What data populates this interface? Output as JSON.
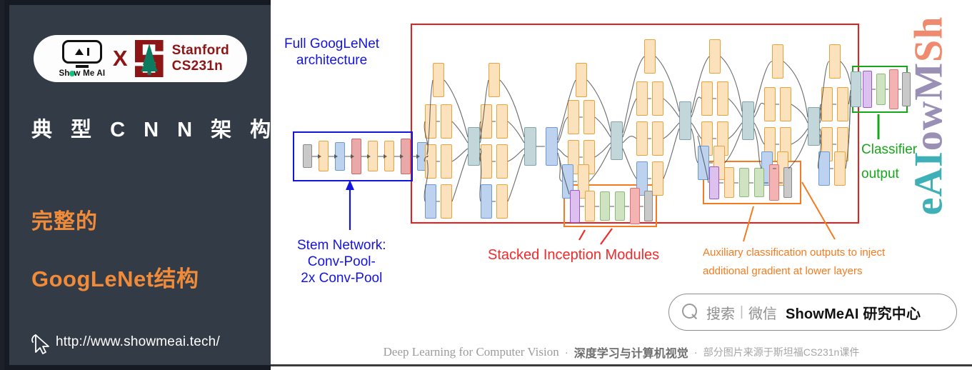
{
  "sidebar": {
    "logo": {
      "showmeai_label": "Show Me AI",
      "x_label": "X",
      "stanford_line1": "Stanford",
      "stanford_line2": "CS231n"
    },
    "title": "典 型 C N N 架 构",
    "subtitle_line1": "完整的",
    "subtitle_line2": "GoogLeNet结构",
    "url": "http://www.showmeai.tech/",
    "cursor_icon": "cursor-pointer-icon",
    "colors": {
      "background": "#333b47",
      "accent_orange": "#f08b3a",
      "stanford_red": "#8c1515"
    }
  },
  "diagram": {
    "title": "Full GoogLeNet architecture",
    "labels": {
      "full_architecture": "Full GoogLeNet\narchitecture",
      "full_architecture_l1": "Full GoogLeNet",
      "full_architecture_l2": "architecture",
      "stem_l1": "Stem Network:",
      "stem_l2": "Conv-Pool-",
      "stem_l3": "2x Conv-Pool",
      "stacked_inception": "Stacked Inception Modules",
      "auxiliary_l1": "Auxiliary classification outputs to inject",
      "auxiliary_l2": "additional gradient at lower layers",
      "classifier_l1": "Classifier",
      "classifier_l2": "output"
    },
    "colors": {
      "full_box": "#ef1c1c",
      "stem_box": "#1414e0",
      "aux_box": "#f47b20",
      "classifier_box": "#17a81a",
      "conv_block": "#fbe2bc",
      "pool_block": "#bcd2ef",
      "concat_block": "#c3d6d9",
      "norm_block": "#e9a9a9",
      "softmax_block": "#f3b3b3",
      "avgpool_block": "#dcc0ee",
      "fc_block": "#cfe3c3",
      "io_block": "#c9c9c9"
    },
    "stem_blocks": [
      "input",
      "conv",
      "pool",
      "norm",
      "conv",
      "conv",
      "norm",
      "pool"
    ],
    "auxiliary_blocks": [
      "avgpool",
      "conv",
      "fc",
      "fc",
      "softmax-activation",
      "output"
    ],
    "classifier_blocks": [
      "avgpool",
      "fc",
      "softmax",
      "output"
    ],
    "inception_module_branches": [
      "1x1 conv",
      "3x3 conv",
      "5x5 conv",
      "3x3 pool"
    ],
    "inception_module_count": 9
  },
  "watermark": {
    "part_a": "ShowMeAI",
    "seg1": "Sh",
    "seg2": "owM",
    "seg3": "eAI"
  },
  "search": {
    "magnifier_icon": "search-icon",
    "placeholder_cn": "搜索",
    "divider": "|",
    "channel": "微信",
    "brand": "ShowMeAI 研究中心"
  },
  "footer": {
    "english": "Deep Learning for Computer Vision",
    "dot": "·",
    "chinese_bold": "深度学习与计算机视觉",
    "dot2": "·",
    "source": "部分图片来源于斯坦福CS231n课件"
  }
}
